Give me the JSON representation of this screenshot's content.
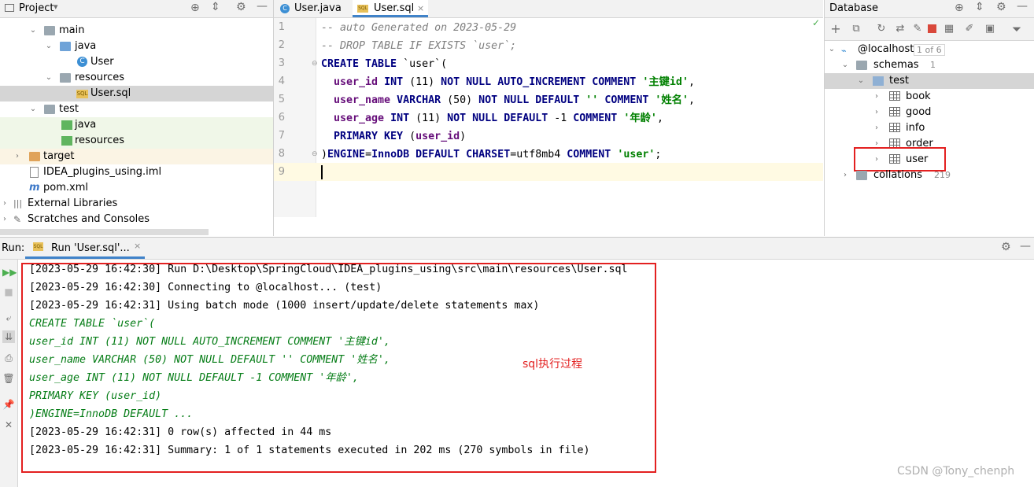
{
  "project": {
    "title": "Project",
    "tree": [
      {
        "label": "main"
      },
      {
        "label": "java"
      },
      {
        "label": "User"
      },
      {
        "label": "resources"
      },
      {
        "label": "User.sql"
      },
      {
        "label": "test"
      },
      {
        "label": "java"
      },
      {
        "label": "resources"
      },
      {
        "label": "target"
      },
      {
        "label": "IDEA_plugins_using.iml"
      },
      {
        "label": "pom.xml"
      },
      {
        "label": "External Libraries"
      },
      {
        "label": "Scratches and Consoles"
      }
    ]
  },
  "editor": {
    "tabs": [
      {
        "label": "User.java"
      },
      {
        "label": "User.sql"
      }
    ],
    "line_numbers": [
      "1",
      "2",
      "3",
      "4",
      "5",
      "6",
      "7",
      "8",
      "9"
    ],
    "code": {
      "l1": "-- auto Generated on 2023-05-29",
      "l2": "-- DROP TABLE IF EXISTS `user`;",
      "l3_kw": "CREATE TABLE",
      "l3_rest": " `user`(",
      "l4_id": "user_id",
      "l4_kw1": "INT",
      "l4_num": " (11) ",
      "l4_kw2": "NOT NULL AUTO_INCREMENT COMMENT",
      "l4_str": "'主键id'",
      "l4_end": ",",
      "l5_id": "user_name",
      "l5_kw1": "VARCHAR",
      "l5_num": " (50) ",
      "l5_kw2": "NOT NULL DEFAULT",
      "l5_str1": "''",
      "l5_kw3": "COMMENT",
      "l5_str2": "'姓名'",
      "l5_end": ",",
      "l6_id": "user_age",
      "l6_kw1": "INT",
      "l6_num": " (11) ",
      "l6_kw2": "NOT NULL DEFAULT",
      "l6_num2": " -1 ",
      "l6_kw3": "COMMENT",
      "l6_str": "'年龄'",
      "l6_end": ",",
      "l7_kw": "PRIMARY KEY",
      "l7_open": " (",
      "l7_id": "user_id",
      "l7_close": ")",
      "l8_open": ")",
      "l8_kw1": "ENGINE",
      "l8_eq1": "=",
      "l8_kw2": "InnoDB DEFAULT CHARSET",
      "l8_eq2": "=utf8mb4 ",
      "l8_kw3": "COMMENT",
      "l8_str": "'user'",
      "l8_end": ";"
    }
  },
  "database": {
    "title": "Database",
    "host": "@localhost",
    "host_badge": "1 of 6",
    "schemas_label": "schemas",
    "schemas_count": "1",
    "schema": "test",
    "tables": [
      "book",
      "good",
      "info",
      "order",
      "user"
    ],
    "collations_label": "collations",
    "collations_count": "219"
  },
  "run": {
    "label": "Run:",
    "tab": "Run 'User.sql'...",
    "lines": [
      {
        "text": "[2023-05-29 16:42:30] Run D:\\Desktop\\SpringCloud\\IDEA_plugins_using\\src\\main\\resources\\User.sql",
        "style": "plain"
      },
      {
        "text": "[2023-05-29 16:42:30] Connecting to @localhost... (test)",
        "style": "plain"
      },
      {
        "text": "[2023-05-29 16:42:31] Using batch mode (1000 insert/update/delete statements max)",
        "style": "plain"
      },
      {
        "text": "CREATE TABLE `user`(",
        "style": "green"
      },
      {
        "text": "user_id INT (11) NOT NULL AUTO_INCREMENT COMMENT '主键id',",
        "style": "green"
      },
      {
        "text": "user_name VARCHAR (50) NOT NULL DEFAULT '' COMMENT '姓名',",
        "style": "green"
      },
      {
        "text": "user_age INT (11) NOT NULL DEFAULT -1 COMMENT '年龄',",
        "style": "green"
      },
      {
        "text": "PRIMARY KEY (user_id)",
        "style": "green"
      },
      {
        "text": ")ENGINE=InnoDB DEFAULT ...",
        "style": "green"
      },
      {
        "text": "[2023-05-29 16:42:31] 0 row(s) affected in 44 ms",
        "style": "plain"
      },
      {
        "text": "[2023-05-29 16:42:31] Summary: 1 of 1 statements executed in 202 ms (270 symbols in file)",
        "style": "plain"
      }
    ],
    "annotation": "sql执行过程"
  },
  "watermark": "CSDN @Tony_chenph",
  "colors": {
    "keyword": "#000080",
    "string": "#008000",
    "identifier": "#660e7a",
    "comment": "#808080",
    "console_sql": "#067d17",
    "annotation_red": "#e32020",
    "selection": "#d5d5d5"
  }
}
